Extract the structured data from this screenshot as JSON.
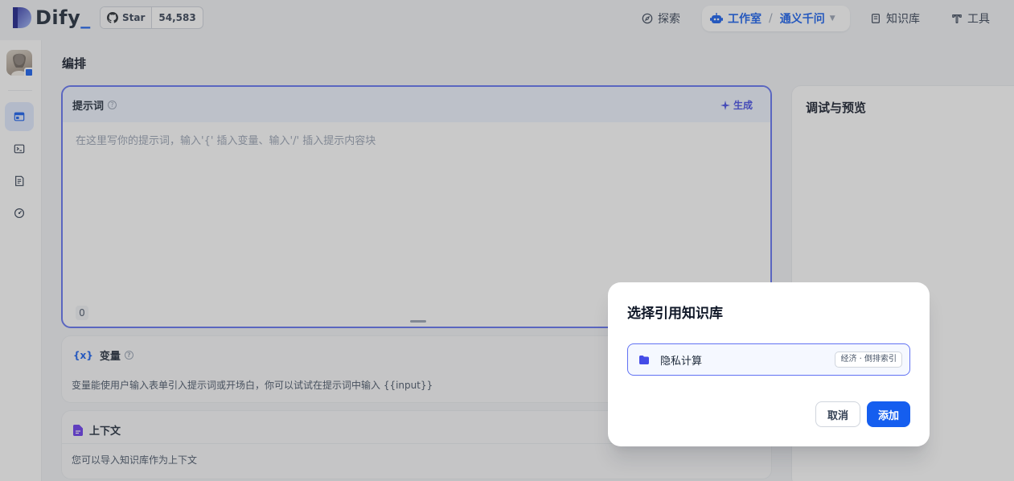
{
  "app": {
    "name": "Dify",
    "name_suffix": "_"
  },
  "github": {
    "star_label": "Star",
    "star_count": "54,583"
  },
  "nav": {
    "explore": "探索",
    "studio": "工作室",
    "app_name": "通义千问",
    "knowledge": "知识库",
    "tools": "工具"
  },
  "sidebar": {
    "items": [
      {
        "name": "orchestrate",
        "icon": "layout-icon",
        "active": true
      },
      {
        "name": "api",
        "icon": "terminal-icon",
        "active": false
      },
      {
        "name": "logs",
        "icon": "file-list-icon",
        "active": false
      },
      {
        "name": "overview",
        "icon": "dashboard-icon",
        "active": false
      }
    ]
  },
  "main": {
    "title": "编排",
    "prompt": {
      "title": "提示词",
      "generate_label": "生成",
      "placeholder": "在这里写你的提示词，输入'{' 插入变量、输入'/' 插入提示内容块",
      "char_count": "0"
    },
    "variables": {
      "icon_text": "{x}",
      "title": "变量",
      "description": "变量能使用户输入表单引入提示词或开场白，你可以试试在提示词中输入 {{input}}"
    },
    "context": {
      "title": "上下文",
      "description": "您可以导入知识库作为上下文"
    }
  },
  "debug": {
    "title": "调试与预览"
  },
  "modal": {
    "title": "选择引用知识库",
    "items": [
      {
        "name": "隐私计算",
        "badge": "经济 · 倒排索引",
        "selected": true
      }
    ],
    "cancel_label": "取消",
    "add_label": "添加"
  },
  "colors": {
    "primary": "#155eef",
    "accent_indigo": "#444ce7",
    "focus_border": "#6172f3"
  }
}
